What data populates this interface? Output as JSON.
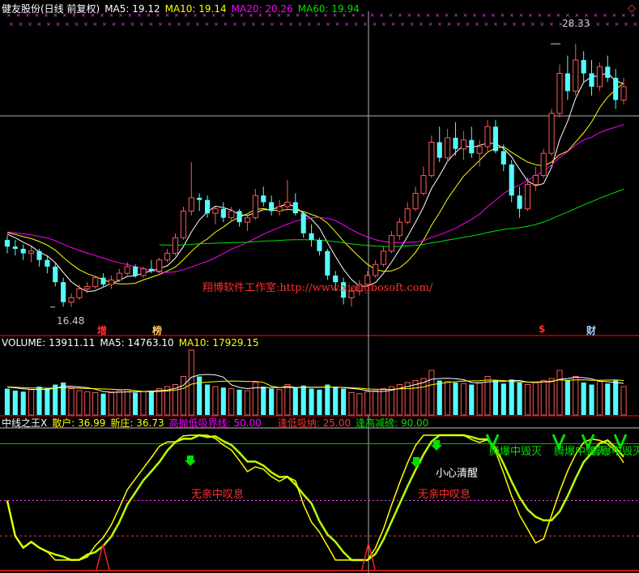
{
  "price_header": {
    "title": "健友股份(日线 前复权)",
    "ma5": "MA5: 19.12",
    "ma10": "MA10: 19.14",
    "ma20": "MA20: 20.26",
    "ma60": "MA60: 19.94"
  },
  "volume_header": {
    "title": "VOLUME: 13911.11",
    "ma5": "MA5: 14763.10",
    "ma10": "MA10: 17929.15"
  },
  "indicator_header": {
    "title": "中线之王X",
    "retail": "散户: 36.99",
    "newdealer": "新庄: 36.73",
    "threshold": "高抛低吸界线: 50.00",
    "low_buy": "逢低吸纳: 25.00",
    "high_sell": "逢高减磅: 90.00"
  },
  "annotations": {
    "high_label": "28.33",
    "low_label": "16.48",
    "watermark": "翔博软件工作室:http://www.xiangbosoft.com/",
    "event_flag_1": "增",
    "event_flag_2": "榜",
    "event_flag_3": "$",
    "event_flag_4": "财",
    "note_1": "无亲中叹息",
    "note_2": "无亲中叹息",
    "note_3": "小心清醒",
    "note_4": "腾爆中毁灭",
    "note_5": "腾爆中毁灭",
    "note_6": "腾爆中毁灭"
  },
  "colors": {
    "up": "#ff5555",
    "down": "#54fcfc",
    "ma5": "#ffffff",
    "ma10": "#ffff00",
    "ma20": "#ff00ff",
    "ma60": "#00e000",
    "separator": "#c00000",
    "indicator_main": "#ffff00",
    "indicator_fast": "#b8ff00"
  },
  "chart_data": {
    "type": "candlestick",
    "title": "健友股份(日线 前复权)",
    "price_range": [
      16.0,
      29.5
    ],
    "high": 28.33,
    "low": 16.48,
    "ohlc": [
      [
        19.5,
        19.7,
        18.9,
        19.2
      ],
      [
        19.2,
        19.5,
        18.8,
        19.1
      ],
      [
        19.1,
        19.3,
        18.6,
        18.9
      ],
      [
        18.9,
        19.2,
        18.5,
        19.0
      ],
      [
        19.0,
        19.1,
        18.3,
        18.6
      ],
      [
        18.6,
        18.8,
        18.0,
        18.3
      ],
      [
        18.3,
        18.5,
        17.4,
        17.6
      ],
      [
        17.6,
        17.8,
        16.5,
        16.7
      ],
      [
        16.7,
        17.1,
        16.48,
        16.9
      ],
      [
        16.9,
        17.5,
        16.8,
        17.3
      ],
      [
        17.3,
        17.6,
        17.1,
        17.4
      ],
      [
        17.4,
        17.9,
        17.3,
        17.8
      ],
      [
        17.8,
        18.0,
        17.4,
        17.5
      ],
      [
        17.5,
        17.9,
        17.3,
        17.7
      ],
      [
        17.7,
        18.2,
        17.6,
        18.0
      ],
      [
        18.0,
        18.5,
        17.9,
        18.3
      ],
      [
        18.3,
        18.4,
        17.8,
        17.9
      ],
      [
        17.9,
        18.3,
        17.8,
        18.2
      ],
      [
        18.2,
        18.6,
        18.0,
        18.1
      ],
      [
        18.1,
        18.7,
        18.0,
        18.6
      ],
      [
        18.6,
        19.1,
        18.5,
        18.9
      ],
      [
        18.9,
        19.8,
        18.8,
        19.6
      ],
      [
        19.6,
        21.0,
        19.5,
        20.8
      ],
      [
        20.8,
        23.0,
        20.6,
        21.4
      ],
      [
        21.4,
        21.6,
        20.8,
        21.3
      ],
      [
        21.3,
        21.5,
        20.5,
        20.7
      ],
      [
        20.7,
        21.0,
        20.2,
        20.9
      ],
      [
        20.9,
        21.2,
        20.3,
        20.5
      ],
      [
        20.5,
        21.0,
        20.3,
        20.8
      ],
      [
        20.8,
        20.9,
        20.1,
        20.3
      ],
      [
        20.3,
        20.6,
        19.9,
        20.5
      ],
      [
        20.5,
        21.8,
        20.4,
        21.5
      ],
      [
        21.5,
        21.9,
        21.0,
        21.2
      ],
      [
        21.2,
        21.5,
        20.6,
        20.8
      ],
      [
        20.8,
        21.3,
        20.6,
        21.0
      ],
      [
        21.0,
        22.2,
        20.9,
        21.2
      ],
      [
        21.2,
        21.6,
        20.6,
        20.7
      ],
      [
        20.7,
        20.8,
        19.6,
        19.8
      ],
      [
        19.8,
        20.2,
        19.2,
        19.5
      ],
      [
        19.5,
        19.6,
        18.8,
        19.0
      ],
      [
        19.0,
        19.1,
        17.7,
        17.9
      ],
      [
        17.9,
        18.1,
        17.2,
        17.6
      ],
      [
        17.6,
        17.8,
        16.6,
        16.9
      ],
      [
        16.9,
        17.4,
        16.5,
        17.2
      ],
      [
        17.2,
        17.7,
        17.0,
        17.5
      ],
      [
        17.5,
        18.1,
        17.4,
        17.9
      ],
      [
        17.9,
        18.6,
        17.8,
        18.4
      ],
      [
        18.4,
        19.2,
        18.3,
        19.0
      ],
      [
        19.0,
        19.9,
        18.9,
        19.7
      ],
      [
        19.7,
        20.5,
        19.5,
        20.3
      ],
      [
        20.3,
        21.2,
        20.2,
        20.9
      ],
      [
        20.9,
        21.9,
        20.8,
        21.6
      ],
      [
        21.6,
        22.8,
        21.5,
        22.4
      ],
      [
        22.4,
        24.2,
        22.3,
        23.9
      ],
      [
        23.9,
        24.6,
        23.0,
        23.2
      ],
      [
        23.2,
        24.5,
        23.0,
        24.1
      ],
      [
        24.1,
        24.8,
        23.3,
        23.6
      ],
      [
        23.6,
        24.4,
        23.1,
        24.0
      ],
      [
        24.0,
        24.6,
        23.2,
        23.4
      ],
      [
        23.4,
        24.0,
        22.8,
        23.7
      ],
      [
        23.7,
        24.9,
        23.5,
        24.6
      ],
      [
        24.6,
        24.9,
        23.4,
        23.5
      ],
      [
        23.5,
        23.8,
        22.6,
        22.9
      ],
      [
        22.9,
        23.1,
        21.2,
        21.5
      ],
      [
        21.5,
        21.9,
        20.5,
        20.9
      ],
      [
        20.9,
        22.3,
        20.8,
        22.0
      ],
      [
        22.0,
        22.8,
        21.7,
        22.4
      ],
      [
        22.4,
        23.6,
        22.3,
        23.4
      ],
      [
        23.4,
        25.4,
        23.3,
        25.2
      ],
      [
        25.2,
        27.4,
        25.0,
        27.0
      ],
      [
        27.0,
        27.8,
        25.8,
        26.2
      ],
      [
        26.2,
        28.33,
        26.0,
        27.6
      ],
      [
        27.6,
        28.0,
        26.6,
        27.0
      ],
      [
        27.0,
        27.6,
        26.0,
        26.4
      ],
      [
        26.4,
        27.5,
        26.2,
        27.3
      ],
      [
        27.3,
        27.8,
        26.6,
        26.8
      ],
      [
        26.8,
        27.2,
        25.4,
        25.8
      ],
      [
        25.8,
        26.8,
        25.6,
        26.4
      ]
    ],
    "volume_range": [
      0,
      32000
    ],
    "volume": [
      13000,
      12000,
      11500,
      12500,
      14000,
      13000,
      15000,
      16000,
      13000,
      12000,
      11500,
      11000,
      10500,
      11000,
      12000,
      12500,
      11000,
      11500,
      12000,
      13000,
      14000,
      15000,
      19000,
      32000,
      19000,
      15000,
      14000,
      13500,
      13000,
      12500,
      12000,
      16000,
      14000,
      13000,
      12500,
      15000,
      13500,
      14500,
      13000,
      12500,
      15000,
      14000,
      13000,
      11000,
      10500,
      11500,
      12000,
      13000,
      14000,
      15000,
      16000,
      17000,
      18000,
      22000,
      17000,
      16500,
      16000,
      15500,
      15000,
      16000,
      19000,
      17000,
      15500,
      17500,
      16000,
      15000,
      16000,
      17000,
      18000,
      22000,
      17000,
      19000,
      16000,
      15000,
      16500,
      15500,
      17000,
      14000
    ],
    "indicator_range": [
      0,
      100
    ],
    "retail": 36.99,
    "newdealer": 36.73,
    "threshold": 50.0,
    "low_buy": 25.0,
    "high_sell": 90.0
  }
}
